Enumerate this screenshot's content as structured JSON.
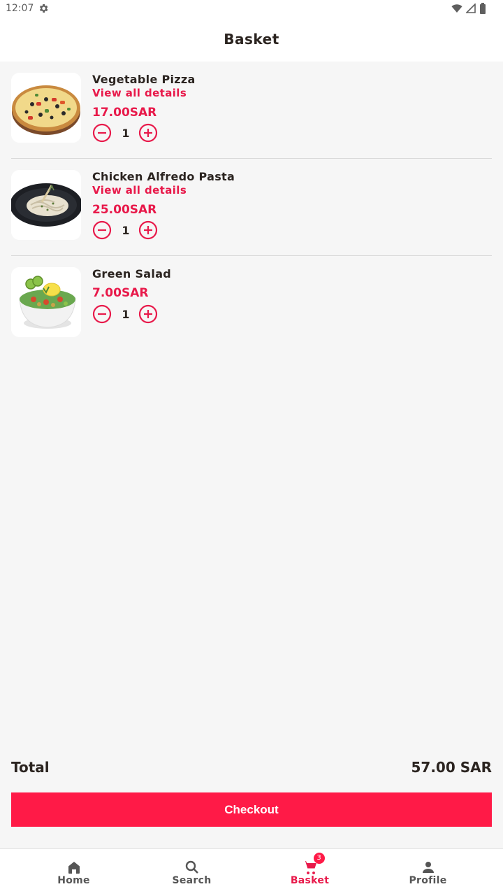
{
  "status_bar": {
    "time": "12:07",
    "icons": [
      "gear-icon",
      "wifi-icon",
      "signal-icon",
      "battery-icon"
    ]
  },
  "app_bar": {
    "title": "Basket"
  },
  "basket_items": [
    {
      "name": "Vegetable Pizza",
      "details_link": "View all details",
      "price": "17.00SAR",
      "quantity": "1",
      "image": "vegetable-pizza-image"
    },
    {
      "name": "Chicken Alfredo Pasta",
      "details_link": "View all details",
      "price": "25.00SAR",
      "quantity": "1",
      "image": "chicken-alfredo-pasta-image"
    },
    {
      "name": "Green Salad",
      "price": "7.00SAR",
      "quantity": "1",
      "image": "green-salad-image"
    }
  ],
  "summary": {
    "total_label": "Total",
    "total_value": "57.00 SAR",
    "checkout_label": "Checkout"
  },
  "bottom_nav": {
    "items": [
      {
        "label": "Home",
        "icon": "home-icon"
      },
      {
        "label": "Search",
        "icon": "search-icon"
      },
      {
        "label": "Basket",
        "icon": "cart-icon",
        "badge": "3",
        "active": true
      },
      {
        "label": "Profile",
        "icon": "person-icon"
      }
    ]
  },
  "colors": {
    "accent": "#e8194a",
    "checkout_button": "#ff1a47",
    "background": "#f6f6f6",
    "text": "#2b2420"
  }
}
